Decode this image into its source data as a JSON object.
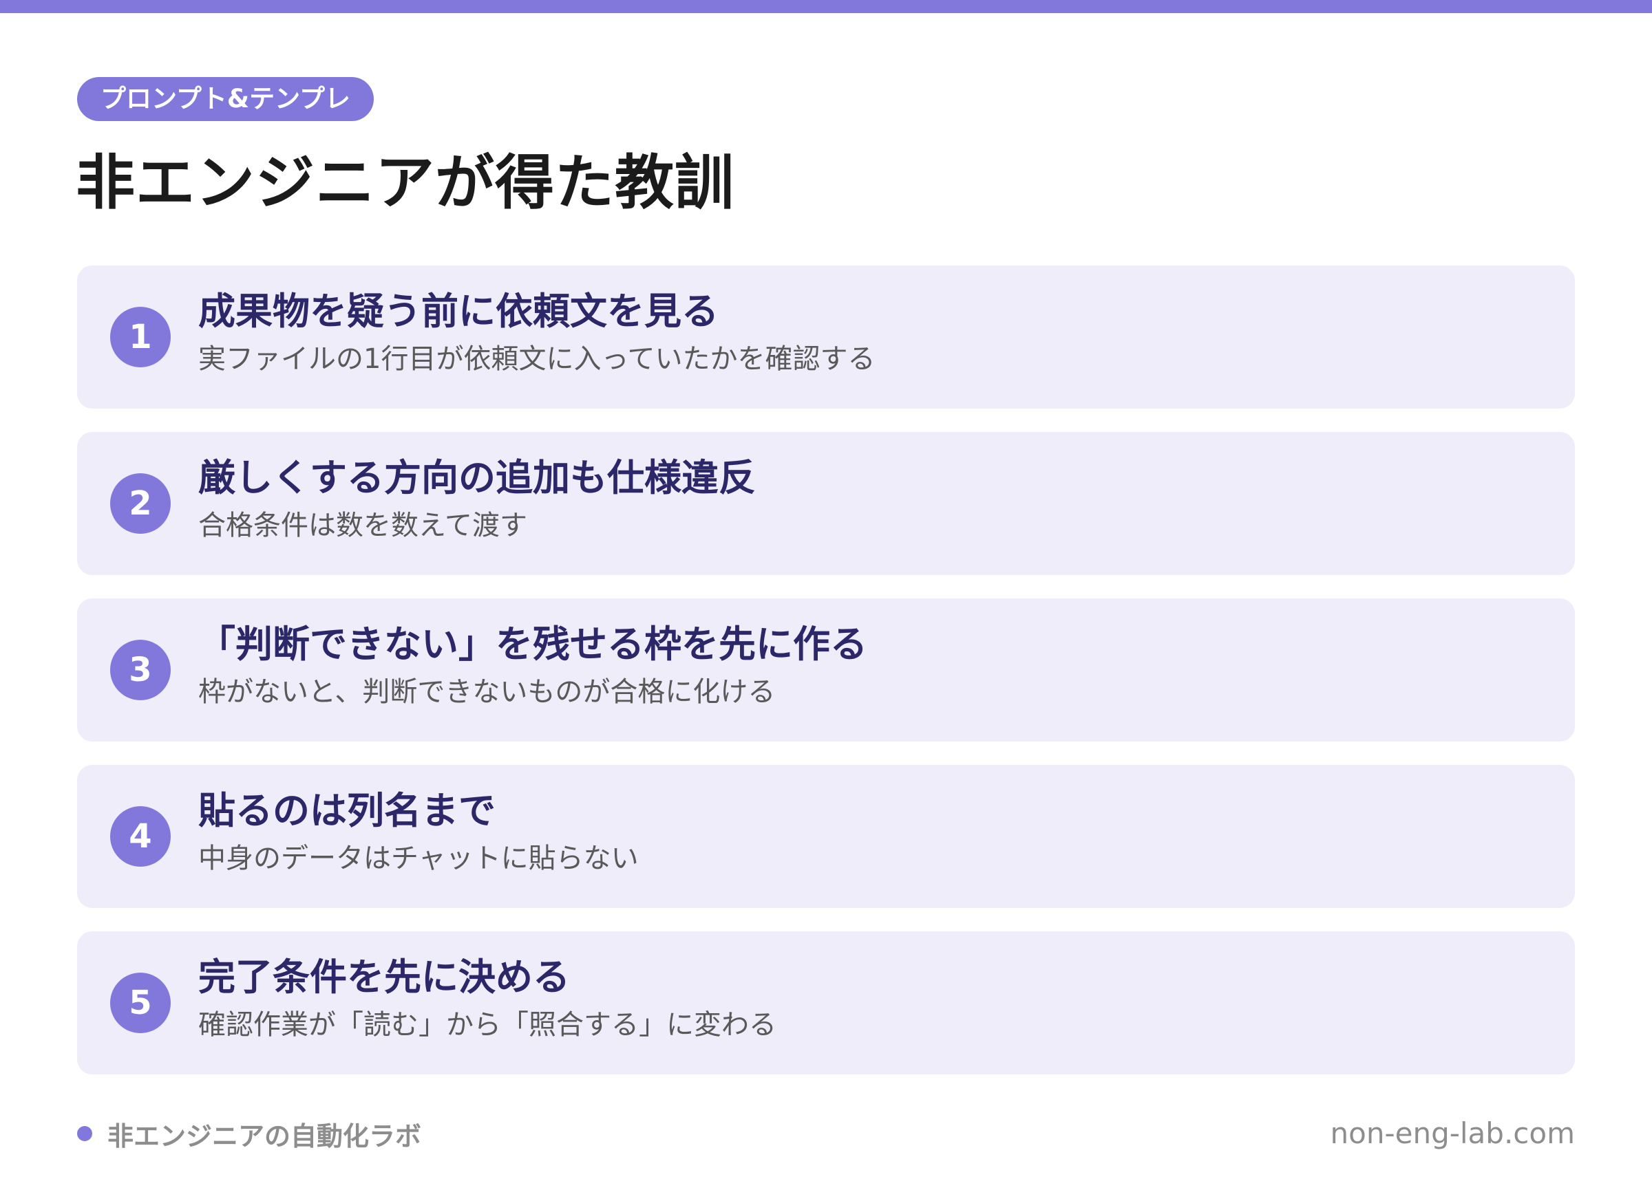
{
  "colors": {
    "accent": "#8278dc",
    "card_bg": "#eeedf9",
    "card_title": "#2c2769",
    "card_sub": "#595959",
    "footer_text": "#8d8d8d"
  },
  "header": {
    "category": "プロンプト&テンプレ",
    "title": "非エンジニアが得た教訓"
  },
  "lessons": [
    {
      "number": "1",
      "title": "成果物を疑う前に依頼文を見る",
      "subtitle": "実ファイルの1行目が依頼文に入っていたかを確認する"
    },
    {
      "number": "2",
      "title": "厳しくする方向の追加も仕様違反",
      "subtitle": "合格条件は数を数えて渡す"
    },
    {
      "number": "3",
      "title": "「判断できない」を残せる枠を先に作る",
      "subtitle": "枠がないと、判断できないものが合格に化ける"
    },
    {
      "number": "4",
      "title": "貼るのは列名まで",
      "subtitle": "中身のデータはチャットに貼らない"
    },
    {
      "number": "5",
      "title": "完了条件を先に決める",
      "subtitle": "確認作業が「読む」から「照合する」に変わる"
    }
  ],
  "footer": {
    "brand": "非エンジニアの自動化ラボ",
    "url": "non-eng-lab.com"
  }
}
